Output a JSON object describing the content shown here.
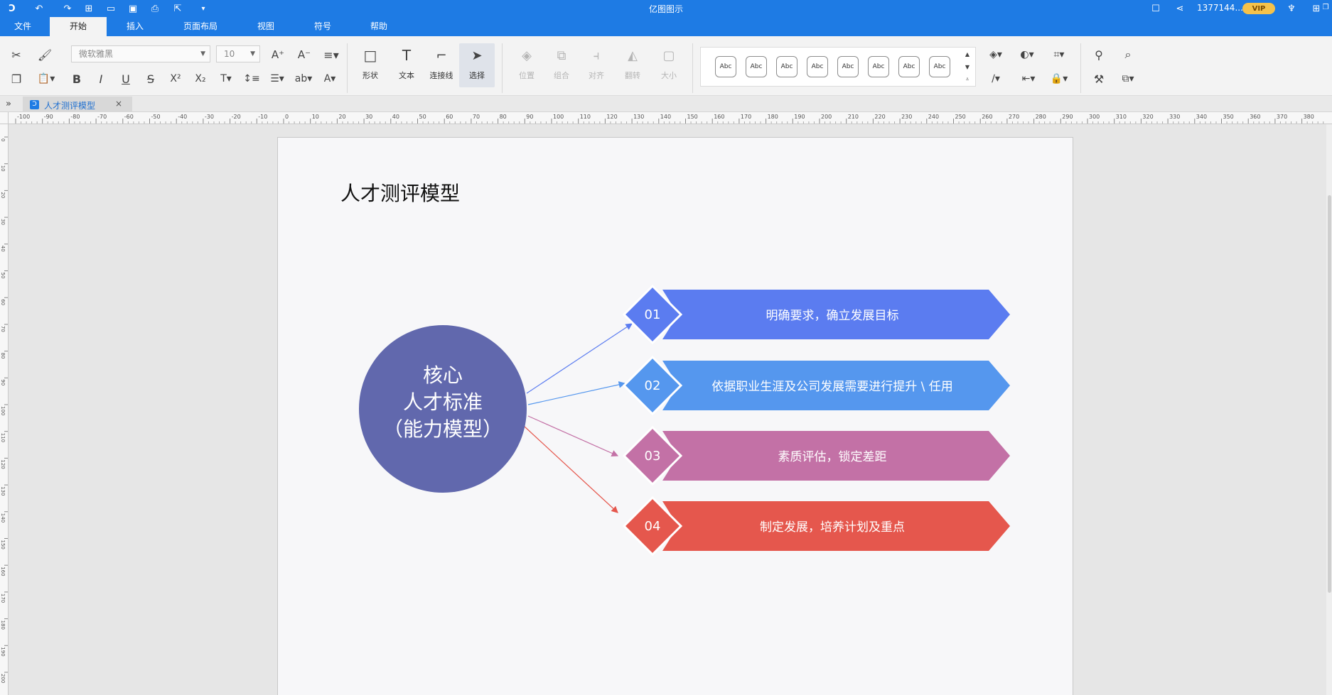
{
  "app": {
    "title": "亿图图示",
    "user": "1377144...",
    "vip_label": "VIP"
  },
  "menu": {
    "items": [
      "文件",
      "开始",
      "插入",
      "页面布局",
      "视图",
      "符号",
      "帮助"
    ],
    "active": "开始"
  },
  "ribbon": {
    "font_family": "微软雅黑",
    "font_size": "10",
    "tools": [
      {
        "label": "形状",
        "icon": "rectangle-icon"
      },
      {
        "label": "文本",
        "icon": "text-t-icon"
      },
      {
        "label": "连接线",
        "icon": "connector-icon"
      },
      {
        "label": "选择",
        "icon": "pointer-icon"
      }
    ],
    "arrange": [
      {
        "label": "位置",
        "icon": "layers-icon"
      },
      {
        "label": "组合",
        "icon": "group-icon"
      },
      {
        "label": "对齐",
        "icon": "align-icon"
      },
      {
        "label": "翻转",
        "icon": "flip-icon"
      },
      {
        "label": "大小",
        "icon": "size-icon"
      }
    ],
    "style_sample": "Abc",
    "style_count": 8
  },
  "tab": {
    "doc_name": "人才测评模型"
  },
  "ruler": {
    "h_labels": [
      "-100",
      "-90",
      "-80",
      "-70",
      "-60",
      "-50",
      "-40",
      "-30",
      "-20",
      "-10",
      "0",
      "10",
      "20",
      "30",
      "40",
      "50",
      "60",
      "70",
      "80",
      "90",
      "100",
      "110",
      "120",
      "130",
      "140",
      "150",
      "160",
      "170",
      "180",
      "190",
      "200",
      "210",
      "220",
      "230",
      "240",
      "250",
      "260",
      "270",
      "280",
      "290",
      "300",
      "310",
      "320",
      "330",
      "340",
      "350",
      "360",
      "370",
      "380"
    ],
    "v_labels": [
      "0",
      "10",
      "20",
      "30",
      "40",
      "50",
      "60",
      "70",
      "80",
      "90",
      "100",
      "110",
      "120",
      "130",
      "140",
      "150",
      "160",
      "170",
      "180",
      "190",
      "200"
    ]
  },
  "diagram": {
    "title": "人才测评模型",
    "center_lines": [
      "核心",
      "人才标准",
      "（能力模型）"
    ],
    "center_color": "#6168ad",
    "items": [
      {
        "num": "01",
        "text": "明确要求，确立发展目标",
        "color": "#5b7cf0"
      },
      {
        "num": "02",
        "text": "依据职业生涯及公司发展需要进行提升 \\ 任用",
        "color": "#5597ee"
      },
      {
        "num": "03",
        "text": "素质评估，锁定差距",
        "color": "#c371a6"
      },
      {
        "num": "04",
        "text": "制定发展，培养计划及重点",
        "color": "#e5574d"
      }
    ]
  },
  "colors": {
    "titlebar": "#1e7be4",
    "ribbon_bg": "#f3f3f3",
    "page_bg": "#f7f7f9"
  }
}
